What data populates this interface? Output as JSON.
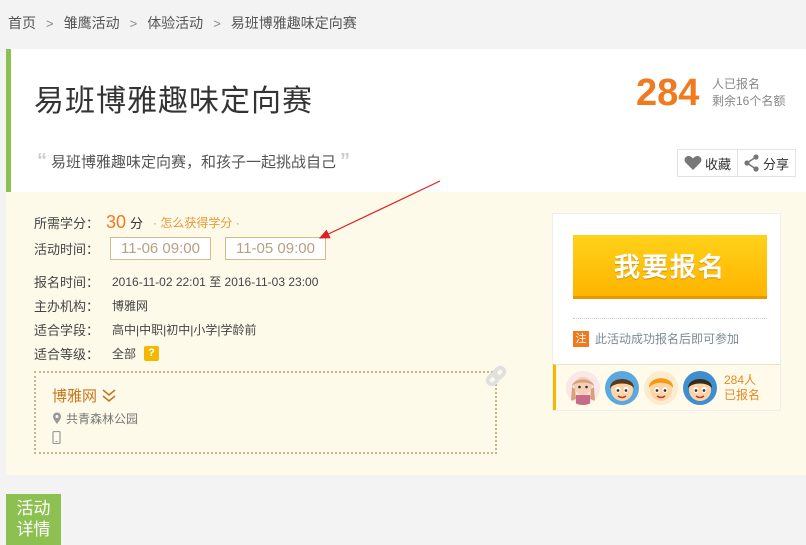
{
  "breadcrumb": {
    "items": [
      "首页",
      "雏鹰活动",
      "体验活动",
      "易班博雅趣味定向赛"
    ],
    "separator": ">"
  },
  "header": {
    "title": "易班博雅趣味定向赛",
    "subtitle": "易班博雅趣味定向赛，和孩子一起挑战自己",
    "registered_count": "284",
    "registered_label": "人已报名",
    "remaining_label": "剩余16个名额"
  },
  "actions": {
    "favorite_label": "收藏",
    "share_label": "分享"
  },
  "info": {
    "credit_label": "所需学分：",
    "credit_value": "30",
    "credit_unit": "分",
    "credit_link": "· 怎么获得学分 ·",
    "activity_time_label": "活动时间：",
    "activity_time_start": "11-06 09:00",
    "activity_time_end": "11-05 09:00",
    "signup_time_label": "报名时间：",
    "signup_time_value": "2016-11-02 22:01 至 2016-11-03 23:00",
    "organizer_label": "主办机构：",
    "organizer_value": "博雅网",
    "grade_label": "适合学段：",
    "grade_value": "高中|中职|初中|小学|学龄前",
    "level_label": "适合等级：",
    "level_value": "全部",
    "level_help": "?"
  },
  "org": {
    "name": "博雅网",
    "location": "共青森林公园"
  },
  "signup": {
    "button_label": "我要报名",
    "note_badge": "注",
    "note_text": "此活动成功报名后即可参加",
    "avatars_count_line1": "284人",
    "avatars_count_line2": "已报名"
  },
  "tabs": {
    "detail_line1": "活动",
    "detail_line2": "详情"
  },
  "colors": {
    "accent_orange": "#f07a20",
    "accent_green": "#8cc152",
    "button_yellow": "#ffc300",
    "panel_cream": "#fefaea"
  }
}
